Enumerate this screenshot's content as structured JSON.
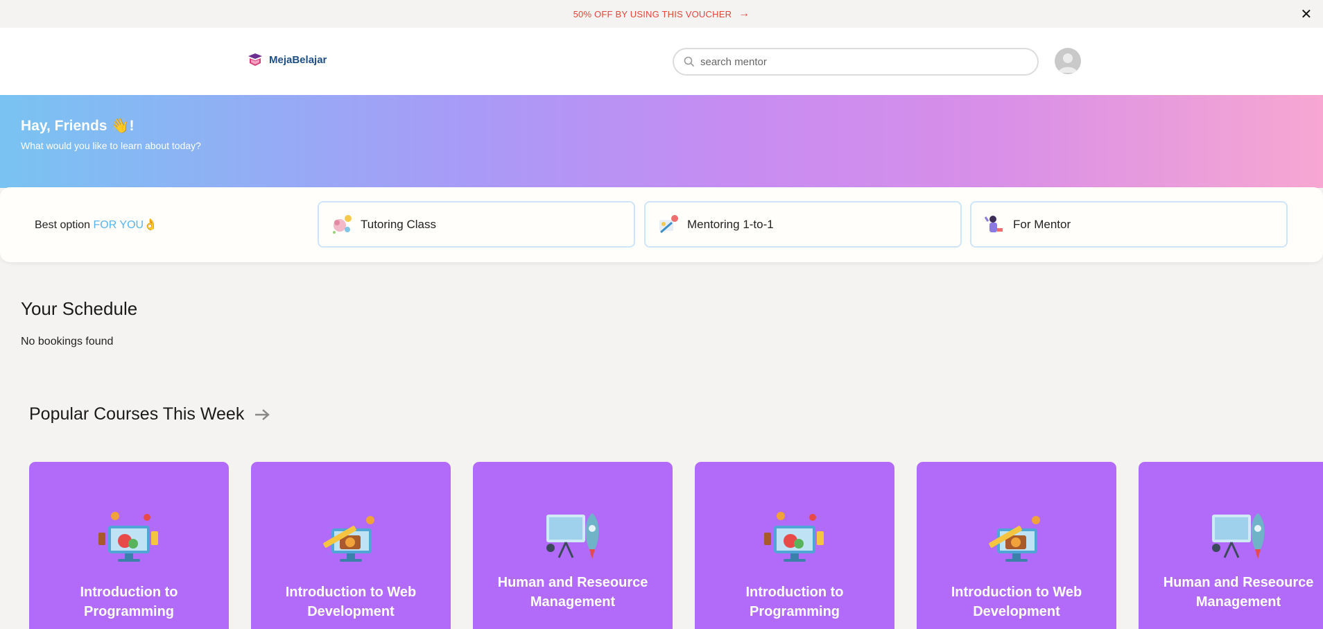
{
  "promo": {
    "text": "50% OFF BY USING THIS VOUCHER",
    "arrow": "→",
    "close": "✕"
  },
  "header": {
    "brand": "MejaBelajar",
    "search": {
      "placeholder": "search mentor",
      "value": ""
    }
  },
  "hero": {
    "greeting": "Hay, Friends 👋!",
    "subtitle": "What would you like to learn about today?"
  },
  "options": {
    "label_prefix": "Best option ",
    "label_highlight": "FOR YOU",
    "label_emoji": "👌",
    "items": [
      {
        "label": "Tutoring Class",
        "icon": "brain-icon"
      },
      {
        "label": "Mentoring 1-to-1",
        "icon": "mentoring-icon"
      },
      {
        "label": "For Mentor",
        "icon": "mentor-person-icon"
      }
    ]
  },
  "schedule": {
    "title": "Your Schedule",
    "empty_text": "No bookings found"
  },
  "popular": {
    "title": "Popular Courses This Week",
    "courses": [
      {
        "title": "Introduction to Programming",
        "icon": "monitor-icon"
      },
      {
        "title": "Introduction to Web Development",
        "icon": "camera-icon"
      },
      {
        "title": "Human and Reseource Management",
        "icon": "presentation-rocket-icon"
      },
      {
        "title": "Introduction to Programming",
        "icon": "monitor-icon"
      },
      {
        "title": "Introduction to Web Development",
        "icon": "camera-icon"
      },
      {
        "title": "Human and Reseource Management",
        "icon": "presentation-rocket-icon"
      }
    ]
  },
  "colors": {
    "accent": "#b26af8",
    "promo": "#e2463a",
    "brand": "#1d4f86",
    "highlight": "#5bb3ea"
  }
}
